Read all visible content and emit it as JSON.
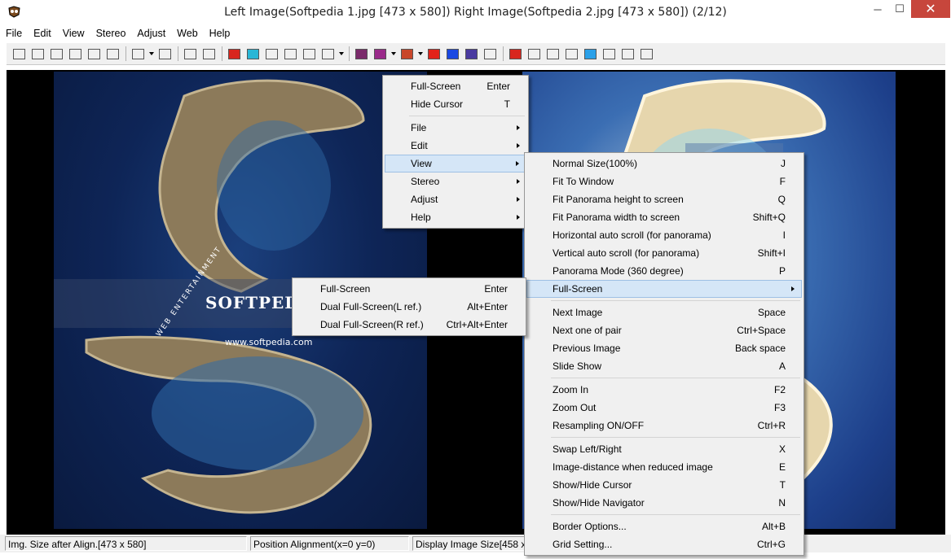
{
  "window": {
    "title": "Left Image(Softpedia 1.jpg [473 x 580]) Right Image(Softpedia 2.jpg [473 x 580])  (2/12)",
    "minimize_glyph": "─",
    "maximize_glyph": "☐",
    "close_glyph": "✕"
  },
  "menubar": [
    "File",
    "Edit",
    "View",
    "Stereo",
    "Adjust",
    "Web",
    "Help"
  ],
  "toolbar": {
    "icons": [
      "open-folder-icon",
      "open-pair-icon",
      "open-folder-2-icon",
      "open-window-icon",
      "save-icon",
      "save-all-icon",
      "sep",
      "crop-align-icon",
      "dd",
      "move-icon",
      "sep",
      "undo-icon",
      "redo-icon",
      "sep",
      "swap-icon",
      "fit-cyan-icon",
      "fit-frame-icon",
      "fit-window-icon",
      "fit-label-icon",
      "zoom-100-icon",
      "dd",
      "sep",
      "interlace-h-icon",
      "interlace-check-icon",
      "dd",
      "checker-icon",
      "dd",
      "anaglyph-rb-icon",
      "anaglyph-br-icon",
      "interlace-v-icon",
      "side-by-side-icon",
      "sep",
      "color-icon",
      "auto-icon",
      "grid-icon",
      "split-icon",
      "snow-icon",
      "html-icon",
      "html-e-icon",
      "help-icon"
    ]
  },
  "images": {
    "left_logo": "SOFTPEDIA",
    "left_url": "www.softpedia.com",
    "left_arc": "WEB ENTERTAINMENT"
  },
  "statusbar": [
    "Img. Size after Align.[473 x 580]",
    "Position Alignment(x=0 y=0)",
    "Display Image Size[458 x"
  ],
  "context_menu": [
    {
      "label": "Full-Screen",
      "shortcut": "Enter"
    },
    {
      "label": "Hide Cursor",
      "shortcut": "T"
    },
    {
      "divider": true
    },
    {
      "label": "File",
      "submenu": true
    },
    {
      "label": "Edit",
      "submenu": true
    },
    {
      "label": "View",
      "submenu": true,
      "highlight": true
    },
    {
      "label": "Stereo",
      "submenu": true
    },
    {
      "label": "Adjust",
      "submenu": true
    },
    {
      "label": "Help",
      "submenu": true
    }
  ],
  "view_menu": [
    {
      "label": "Normal Size(100%)",
      "shortcut": "J"
    },
    {
      "label": "Fit To Window",
      "shortcut": "F"
    },
    {
      "label": "Fit Panorama height to screen",
      "shortcut": "Q"
    },
    {
      "label": "Fit Panorama width to screen",
      "shortcut": "Shift+Q"
    },
    {
      "label": "Horizontal auto scroll (for panorama)",
      "shortcut": "I"
    },
    {
      "label": "Vertical auto scroll (for panorama)",
      "shortcut": "Shift+I"
    },
    {
      "label": "Panorama Mode (360 degree)",
      "shortcut": "P"
    },
    {
      "label": "Full-Screen",
      "submenu": true,
      "highlight": true
    },
    {
      "divider": true
    },
    {
      "label": "Next Image",
      "shortcut": "Space"
    },
    {
      "label": "Next one of pair",
      "shortcut": "Ctrl+Space"
    },
    {
      "label": "Previous Image",
      "shortcut": "Back space"
    },
    {
      "label": "Slide Show",
      "shortcut": "A"
    },
    {
      "divider": true
    },
    {
      "label": "Zoom In",
      "shortcut": "F2"
    },
    {
      "label": "Zoom Out",
      "shortcut": "F3"
    },
    {
      "label": "Resampling ON/OFF",
      "shortcut": "Ctrl+R"
    },
    {
      "divider": true
    },
    {
      "label": "Swap Left/Right",
      "shortcut": "X"
    },
    {
      "label": "Image-distance when reduced image",
      "shortcut": "E"
    },
    {
      "label": "Show/Hide Cursor",
      "shortcut": "T"
    },
    {
      "label": "Show/Hide Navigator",
      "shortcut": "N"
    },
    {
      "divider": true
    },
    {
      "label": "Border Options...",
      "shortcut": "Alt+B"
    },
    {
      "label": "Grid Setting...",
      "shortcut": "Ctrl+G"
    }
  ],
  "fullscreen_menu": [
    {
      "label": "Full-Screen",
      "shortcut": "Enter"
    },
    {
      "label": "Dual Full-Screen(L ref.)",
      "shortcut": "Alt+Enter"
    },
    {
      "label": "Dual Full-Screen(R ref.)",
      "shortcut": "Ctrl+Alt+Enter"
    }
  ]
}
